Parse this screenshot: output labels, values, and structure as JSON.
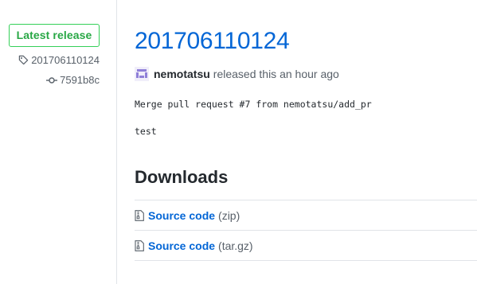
{
  "sidebar": {
    "badge": "Latest release",
    "tag": "201706110124",
    "commit": "7591b8c"
  },
  "release": {
    "title": "201706110124",
    "author": "nemotatsu",
    "released_text": "released this an hour ago",
    "body": [
      "Merge pull request #7 from nemotatsu/add_pr",
      "test"
    ]
  },
  "downloads": {
    "heading": "Downloads",
    "items": [
      {
        "label": "Source code",
        "ext": "(zip)"
      },
      {
        "label": "Source code",
        "ext": "(tar.gz)"
      }
    ]
  },
  "colors": {
    "link": "#0366d6",
    "badge": "#28a745",
    "muted": "#586069",
    "border": "#e1e4e8"
  },
  "icons": {
    "tag": "tag-icon",
    "commit": "git-commit-icon",
    "file": "file-zip-icon"
  }
}
